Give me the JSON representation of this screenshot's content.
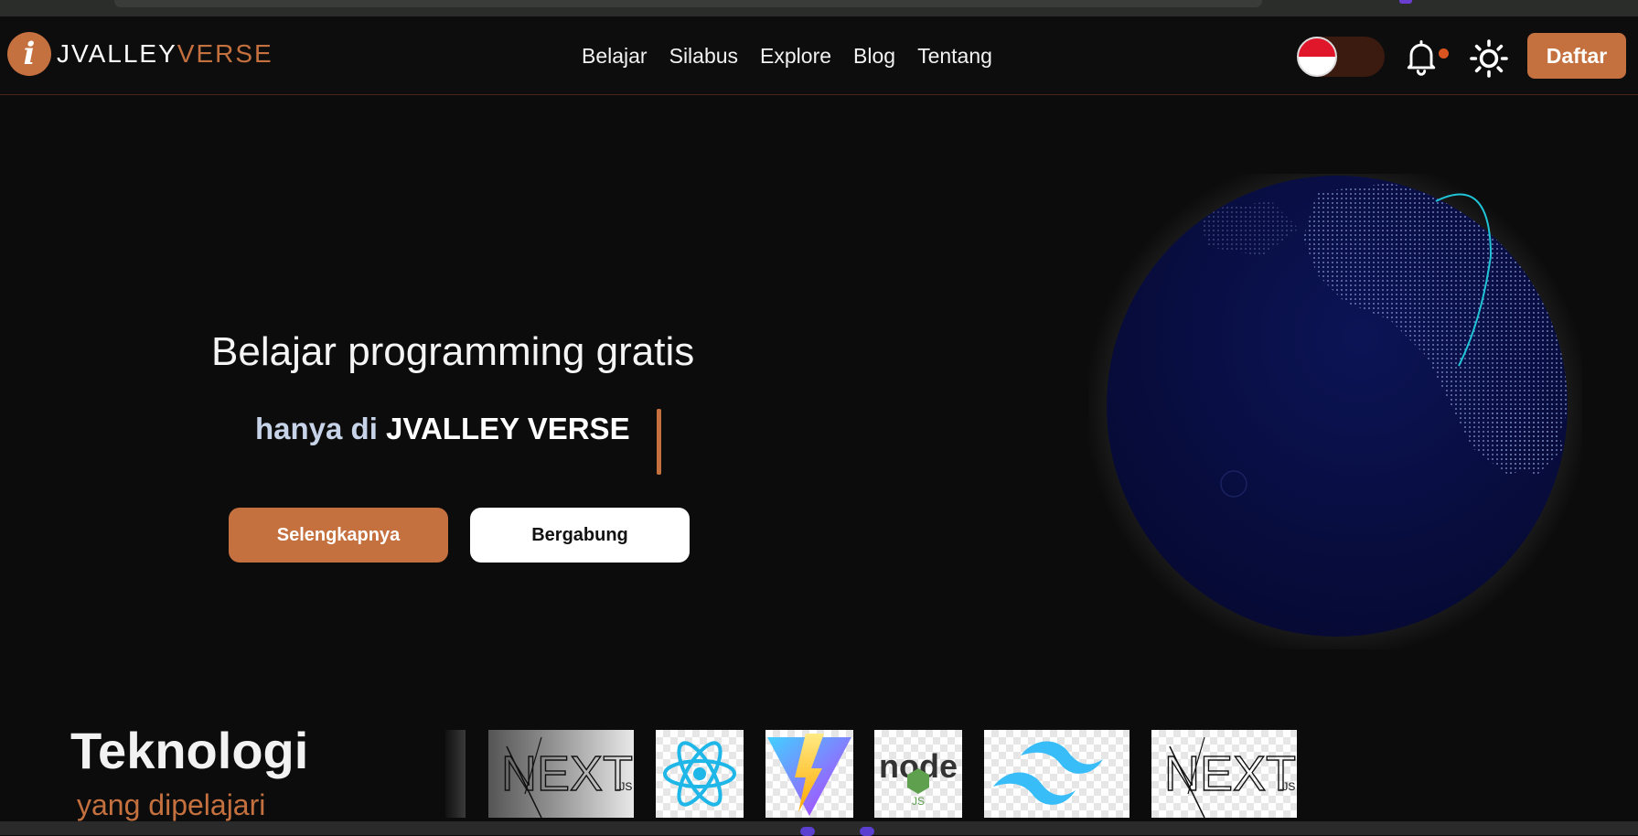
{
  "navbar": {
    "logo_mark": "i",
    "logo_text_white": "JVALLEY",
    "logo_text_orange": "VERSE",
    "links": [
      "Belajar",
      "Silabus",
      "Explore",
      "Blog",
      "Tentang"
    ],
    "register_label": "Daftar"
  },
  "hero": {
    "title": "Belajar programming gratis",
    "subtitle_prefix": "hanya di",
    "subtitle_brand": "JVALLEY VERSE",
    "more_button": "Selengkapnya",
    "join_button": "Bergabung"
  },
  "technologies": {
    "heading": "Teknologi",
    "subheading": "yang dipelajari",
    "logos": [
      "next-js-logo",
      "react-logo",
      "vite-logo",
      "nodejs-logo",
      "tailwind-logo",
      "next-js-logo"
    ],
    "next_label": "NEXT",
    "next_suffix": ".JS",
    "node_label": "node",
    "node_badge": "JS"
  },
  "colors": {
    "accent": "#c4703f",
    "background": "#0c0c0c",
    "globe": "#0a0f3f"
  }
}
